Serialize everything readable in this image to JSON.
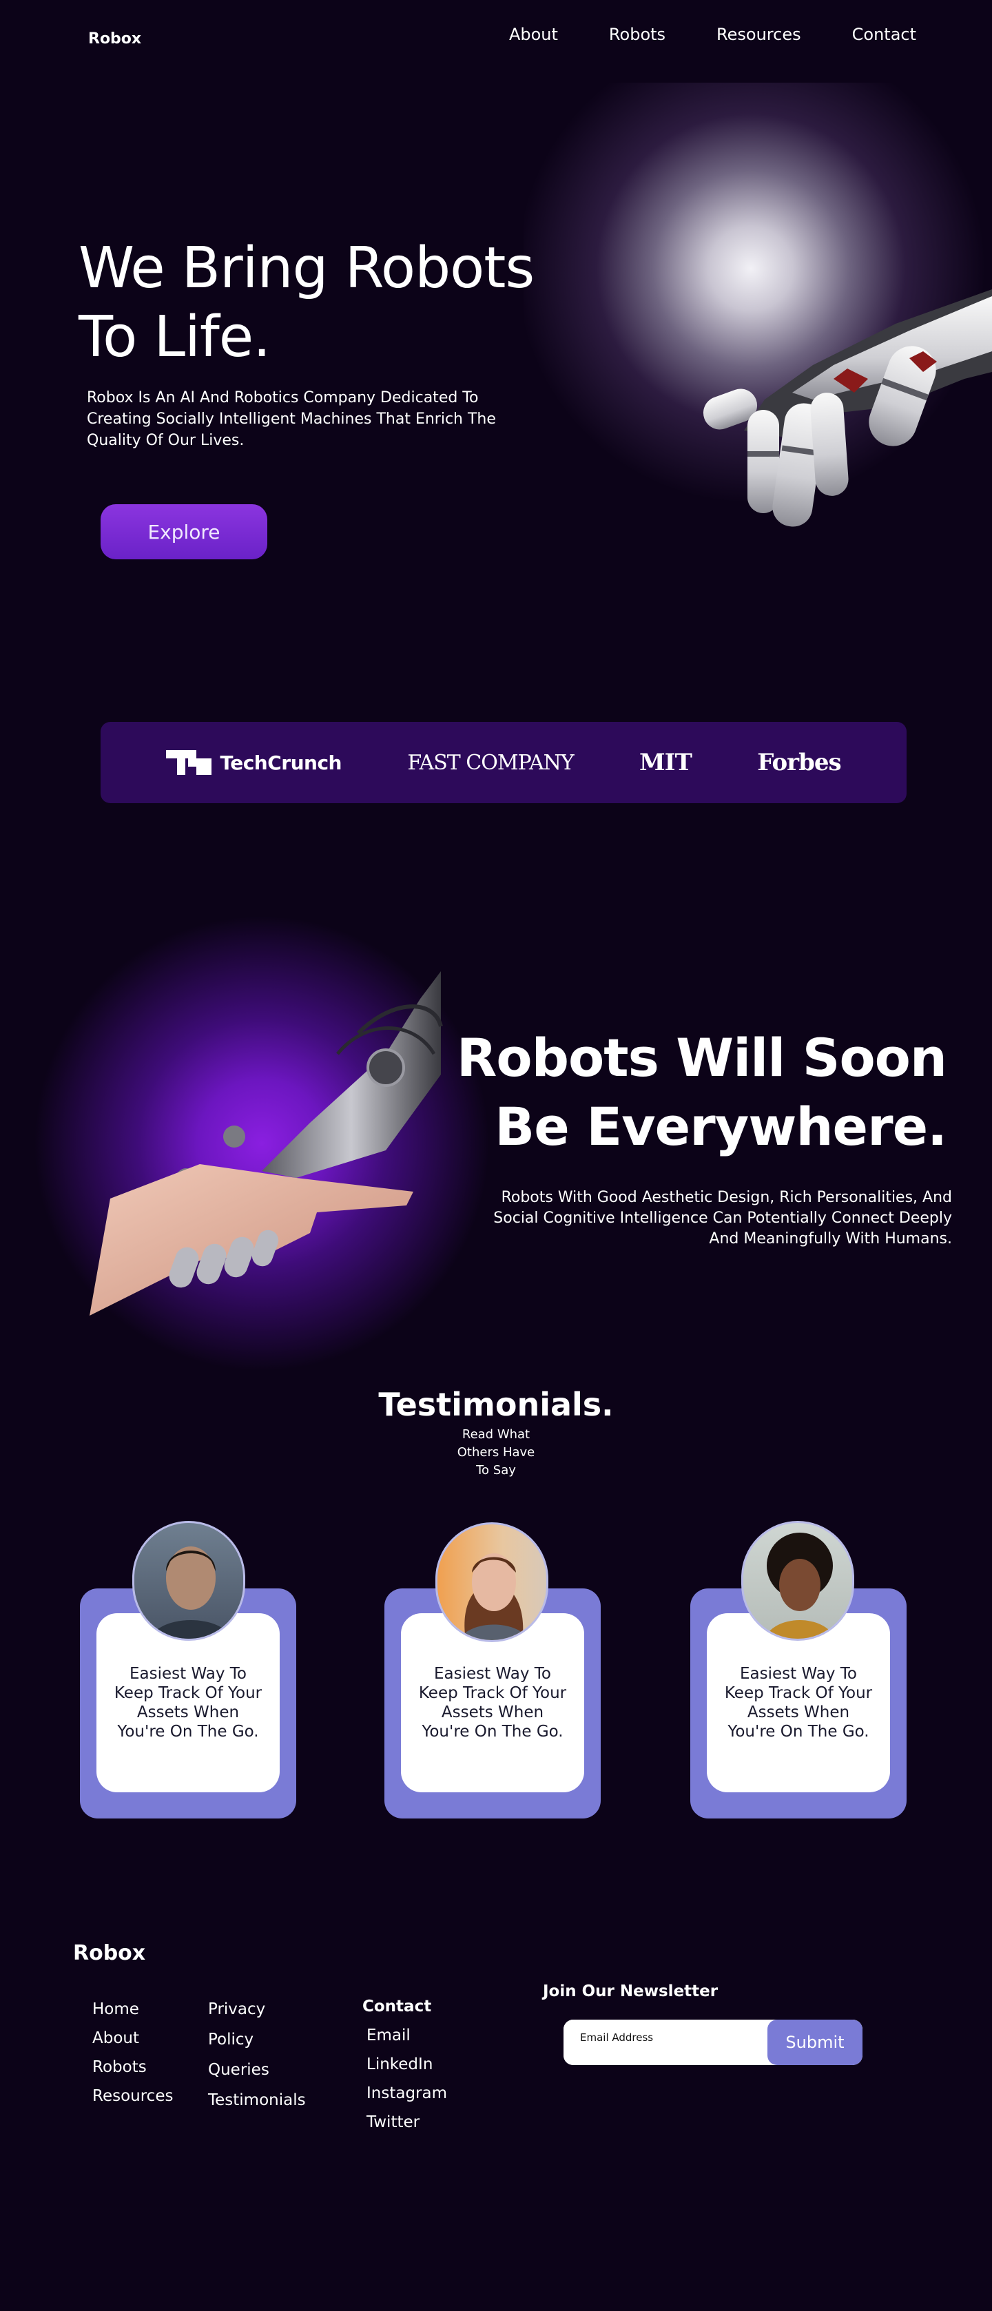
{
  "nav": {
    "logo": "Robox",
    "links": [
      "About",
      "Robots",
      "Resources",
      "Contact"
    ]
  },
  "hero": {
    "title": "We Bring Robots To Life.",
    "subtitle": "Robox Is An AI And Robotics Company Dedicated To Creating Socially Intelligent Machines That Enrich The Quality Of Our Lives.",
    "cta": "Explore"
  },
  "press": {
    "logos": [
      "TechCrunch",
      "FAST COMPANY",
      "MIT",
      "Forbes"
    ]
  },
  "section2": {
    "title": "Robots Will Soon Be Everywhere.",
    "subtitle": "Robots With Good Aesthetic Design, Rich Personalities, And Social Cognitive Intelligence Can Potentially Connect Deeply And Meaningfully With Humans."
  },
  "testimonials": {
    "title": "Testimonials.",
    "subtitle": "Read What Others Have To Say",
    "cards": [
      {
        "quote": "Easiest Way To Keep Track Of Your Assets When You're On The Go."
      },
      {
        "quote": "Easiest Way To Keep Track Of Your Assets When You're On The Go."
      },
      {
        "quote": "Easiest Way To Keep Track Of Your Assets When You're On The Go."
      }
    ]
  },
  "footer": {
    "logo": "Robox",
    "col1": [
      "Home",
      "About",
      "Robots",
      "Resources"
    ],
    "col2": [
      "Privacy",
      "Policy",
      "Queries",
      "Testimonials"
    ],
    "contact_heading": "Contact",
    "col3": [
      "Email",
      "LinkedIn",
      "Instagram",
      "Twitter"
    ],
    "newsletter_title": "Join Our Newsletter",
    "email_placeholder": "Email Address",
    "submit": "Submit"
  }
}
